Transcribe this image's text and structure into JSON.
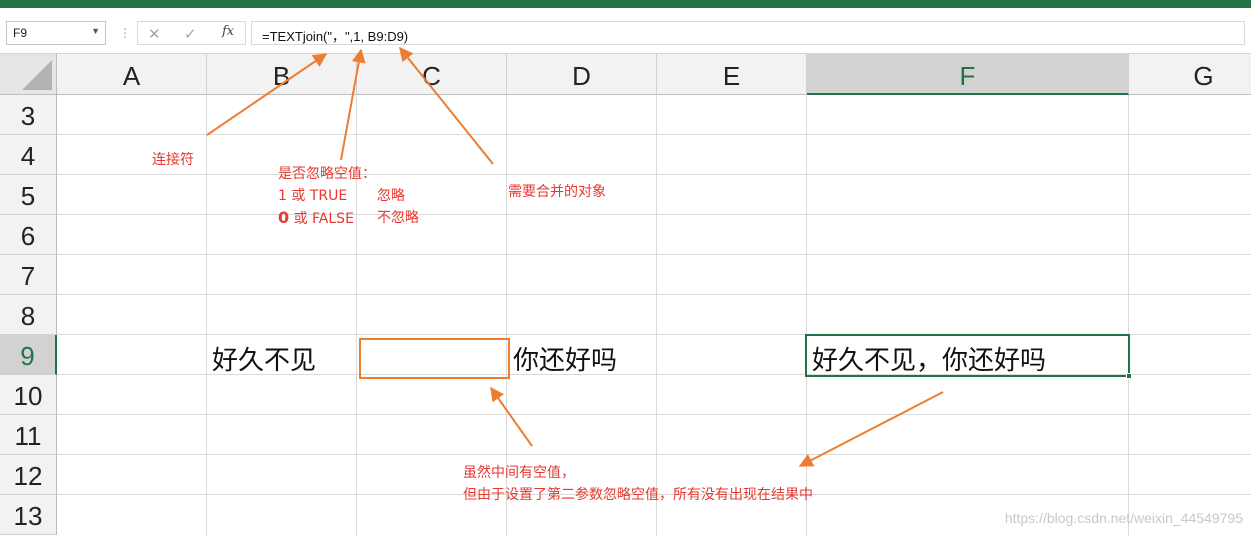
{
  "name_box": {
    "value": "F9"
  },
  "formula_bar": {
    "cancel_icon": "✕",
    "enter_icon": "✓",
    "fx_label": "fx",
    "formula": "=TEXTjoin(\"，\",1, B9:D9)"
  },
  "columns": [
    "A",
    "B",
    "C",
    "D",
    "E",
    "F",
    "G"
  ],
  "selected_column": "F",
  "rows": [
    "3",
    "4",
    "5",
    "6",
    "7",
    "8",
    "9",
    "10",
    "11",
    "12",
    "13"
  ],
  "selected_row": "9",
  "cells": {
    "B9": "好久不见",
    "C9": "",
    "D9": "你还好吗",
    "F9": "好久不见，你还好吗"
  },
  "annotations": {
    "connector": "连接符",
    "ignore_title": "是否忽略空值：",
    "ignore_true": "1 或 TRUE",
    "ignore_true_desc": "忽略",
    "ignore_false_zero": "0",
    "ignore_false": " 或 FALSE",
    "ignore_false_desc": "不忽略",
    "merge_target": "需要合并的对象",
    "result_line1": "虽然中间有空值，",
    "result_line2": "但由于设置了第二参数忽略空值，所有没有出现在结果中"
  },
  "colors": {
    "accent": "#217346",
    "annotation": "#e8382f",
    "arrow": "#ed7d31"
  },
  "watermark": "https://blog.csdn.net/weixin_44549795"
}
